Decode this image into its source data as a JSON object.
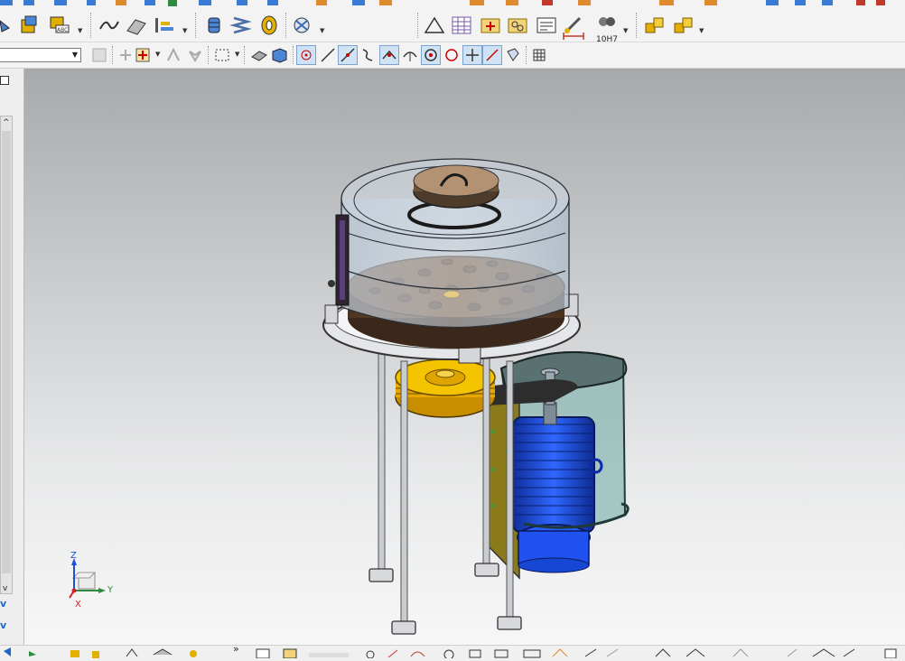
{
  "toolbar": {
    "tolerance_label": "10H7",
    "more_glyph": "»"
  },
  "left_panel": {
    "scroll_up": "^",
    "scroll_down": "v",
    "chev1": "v",
    "chev2": "v"
  },
  "triad": {
    "x": "X",
    "y": "Y",
    "z": "Z"
  },
  "colors": {
    "cad_blue": "#1d4fd8",
    "pulley_yellow": "#f5c400",
    "cake_brown": "#6a4a2f",
    "guard_teal": "#5e9c96"
  }
}
